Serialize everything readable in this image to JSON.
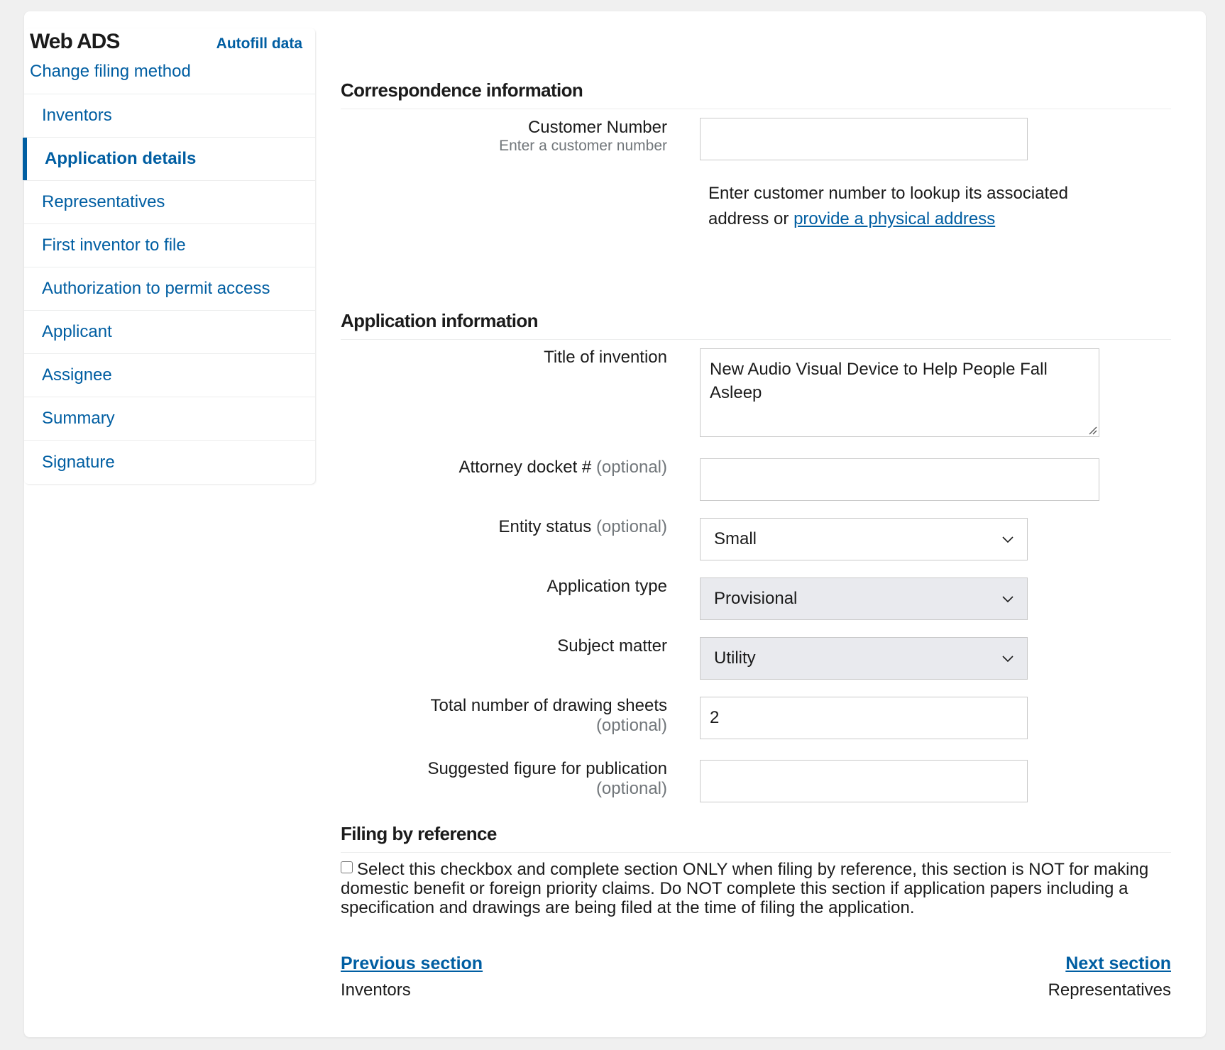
{
  "sidebar": {
    "title": "Web ADS",
    "autofill_label": "Autofill data",
    "change_filing_label": "Change filing method",
    "items": [
      {
        "label": "Inventors",
        "active": false
      },
      {
        "label": "Application details",
        "active": true
      },
      {
        "label": "Representatives",
        "active": false
      },
      {
        "label": "First inventor to file",
        "active": false
      },
      {
        "label": "Authorization to permit access",
        "active": false
      },
      {
        "label": "Applicant",
        "active": false
      },
      {
        "label": "Assignee",
        "active": false
      },
      {
        "label": "Summary",
        "active": false
      },
      {
        "label": "Signature",
        "active": false
      }
    ]
  },
  "correspondence": {
    "title": "Correspondence information",
    "customer_number_label": "Customer Number",
    "customer_number_hint": "Enter a customer number",
    "customer_number_value": "",
    "lookup_text": "Enter customer number to lookup its associated address or ",
    "lookup_link": "provide a physical address"
  },
  "application": {
    "title": "Application information",
    "title_of_invention_label": "Title of invention",
    "title_of_invention_value": "New Audio Visual Device to Help People Fall Asleep",
    "docket_label": "Attorney docket #",
    "optional": "(optional)",
    "docket_value": "",
    "entity_status_label": "Entity status",
    "entity_status_value": "Small",
    "application_type_label": "Application type",
    "application_type_value": "Provisional",
    "subject_matter_label": "Subject matter",
    "subject_matter_value": "Utility",
    "drawing_sheets_label": "Total number of drawing sheets",
    "drawing_sheets_value": "2",
    "suggested_figure_label": "Suggested figure for publication",
    "suggested_figure_value": ""
  },
  "filing_by_reference": {
    "title": "Filing by reference",
    "checked": false,
    "checkbox_text": "Select this checkbox and complete section ONLY when filing by reference, this section is NOT for making domestic benefit or foreign priority claims. Do NOT complete this section if application papers including a specification and drawings are being filed at the time of filing the application."
  },
  "navigation": {
    "previous_label": "Previous section",
    "previous_target": "Inventors",
    "next_label": "Next section",
    "next_target": "Representatives"
  },
  "colors": {
    "link": "#005ea2",
    "disabled_field": "#e9eaee",
    "page_background": "#f0f0f0"
  }
}
